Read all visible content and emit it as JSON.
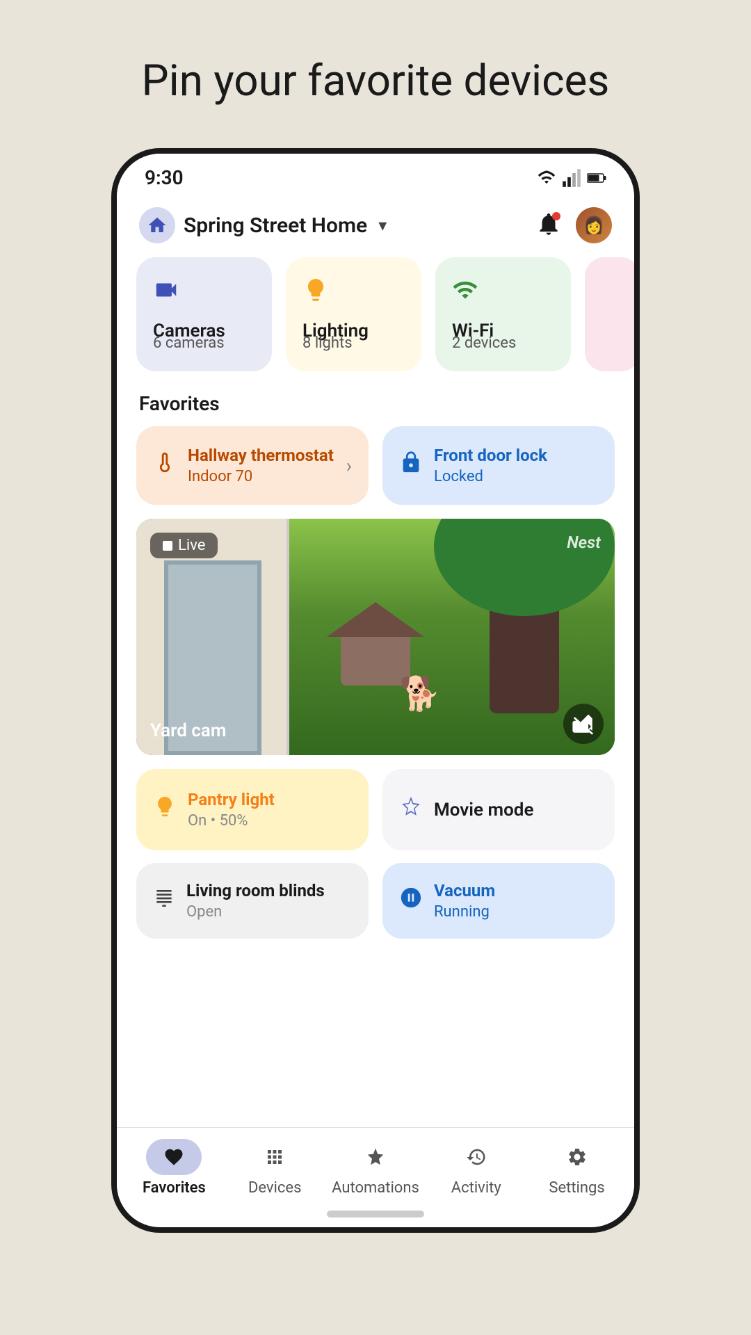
{
  "page": {
    "title": "Pin your favorite devices"
  },
  "status_bar": {
    "time": "9:30"
  },
  "header": {
    "home_name": "Spring Street Home",
    "dropdown_icon": "chevron-down"
  },
  "categories": [
    {
      "id": "cameras",
      "icon": "📷",
      "name": "Cameras",
      "count": "6 cameras",
      "bg": "cameras"
    },
    {
      "id": "lighting",
      "icon": "🕯",
      "name": "Lighting",
      "count": "8 lights",
      "bg": "lighting"
    },
    {
      "id": "wifi",
      "icon": "📶",
      "name": "Wi-Fi",
      "count": "2 devices",
      "bg": "wifi"
    }
  ],
  "favorites_label": "Favorites",
  "favorites": [
    {
      "id": "thermostat",
      "name": "Hallway thermostat",
      "sub": "Indoor 70",
      "icon": "🌡",
      "type": "thermostat"
    },
    {
      "id": "doorlock",
      "name": "Front door lock",
      "sub": "Locked",
      "icon": "🔒",
      "type": "doorlock"
    }
  ],
  "camera": {
    "live_label": "Live",
    "brand": "Nest",
    "name": "Yard cam"
  },
  "pinned_items": [
    {
      "id": "pantry",
      "type": "pantry",
      "name": "Pantry light",
      "sub": "On • 50%",
      "icon": "💡"
    },
    {
      "id": "movie",
      "type": "movie",
      "name": "Movie mode",
      "icon": "✦"
    }
  ],
  "pinned_items2": [
    {
      "id": "blinds",
      "type": "blinds",
      "name": "Living room blinds",
      "sub": "Open",
      "icon": "⊞"
    },
    {
      "id": "vacuum",
      "type": "vacuum",
      "name": "Vacuum",
      "sub": "Running",
      "icon": "🤖"
    }
  ],
  "bottom_nav": [
    {
      "id": "favorites",
      "label": "Favorites",
      "icon": "♥",
      "active": true
    },
    {
      "id": "devices",
      "label": "Devices",
      "icon": "⊞",
      "active": false
    },
    {
      "id": "automations",
      "label": "Automations",
      "icon": "✦",
      "active": false
    },
    {
      "id": "activity",
      "label": "Activity",
      "icon": "⏱",
      "active": false
    },
    {
      "id": "settings",
      "label": "Settings",
      "icon": "⚙",
      "active": false
    }
  ]
}
